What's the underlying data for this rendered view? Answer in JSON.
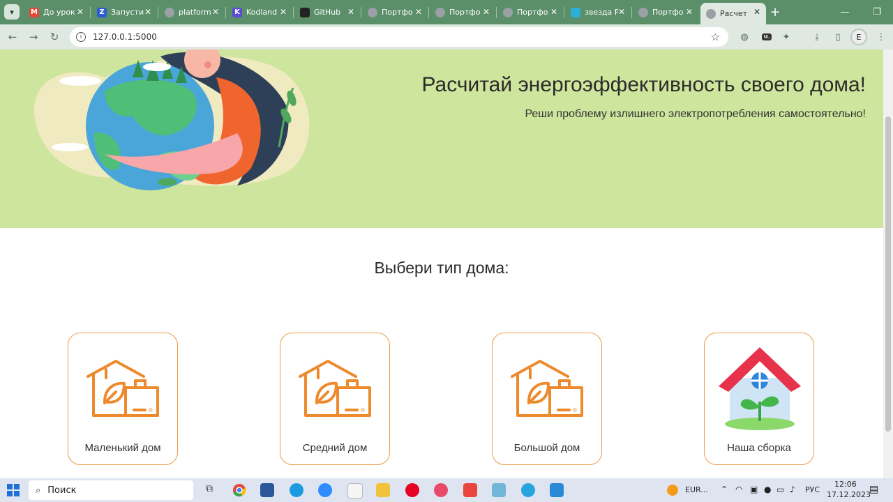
{
  "browser": {
    "tabs": [
      {
        "title": "До урок",
        "icon": "gmail-icon",
        "color": "#ea4335",
        "glyph": "M"
      },
      {
        "title": "Запусти",
        "icon": "zoho-icon",
        "color": "#2a5bd7",
        "glyph": "Z"
      },
      {
        "title": "platform",
        "icon": "globe-icon",
        "color": "#9aa0a6",
        "glyph": ""
      },
      {
        "title": "Kodland",
        "icon": "kodland-icon",
        "color": "#5b4bd6",
        "glyph": "K"
      },
      {
        "title": "GitHub",
        "icon": "github-icon",
        "color": "#222222",
        "glyph": ""
      },
      {
        "title": "Портфо",
        "icon": "globe-icon",
        "color": "#9aa0a6",
        "glyph": ""
      },
      {
        "title": "Портфо",
        "icon": "globe-icon",
        "color": "#9aa0a6",
        "glyph": ""
      },
      {
        "title": "Портфо",
        "icon": "globe-icon",
        "color": "#9aa0a6",
        "glyph": ""
      },
      {
        "title": "звезда Р",
        "icon": "app-icon",
        "color": "#2ab0d9",
        "glyph": ""
      },
      {
        "title": "Портфо",
        "icon": "globe-icon",
        "color": "#9aa0a6",
        "glyph": ""
      },
      {
        "title": "Расчет",
        "icon": "globe-icon",
        "color": "#9aa0a6",
        "glyph": "",
        "active": true
      }
    ],
    "url": "127.0.0.1:5000",
    "profile_initial": "E",
    "extension_badge": "NL"
  },
  "page": {
    "hero": {
      "title": "Расчитай энергоэффективность своего дома!",
      "subtitle": "Реши проблему излишнего электропотребления самостоятельно!"
    },
    "section_title": "Выбери тип дома:",
    "cards": [
      {
        "label": "Маленький дом",
        "icon": "eco-house-icon"
      },
      {
        "label": "Средний дом",
        "icon": "eco-house-icon"
      },
      {
        "label": "Большой дом",
        "icon": "eco-house-icon"
      },
      {
        "label": "Наша сборка",
        "icon": "custom-house-icon"
      }
    ],
    "colors": {
      "hero_bg": "#cde59c",
      "accent": "#ee8a2e"
    }
  },
  "taskbar": {
    "search_placeholder": "Поиск",
    "weather": "EUR...",
    "language": "РУС",
    "time": "12:06",
    "date": "17.12.2023"
  }
}
